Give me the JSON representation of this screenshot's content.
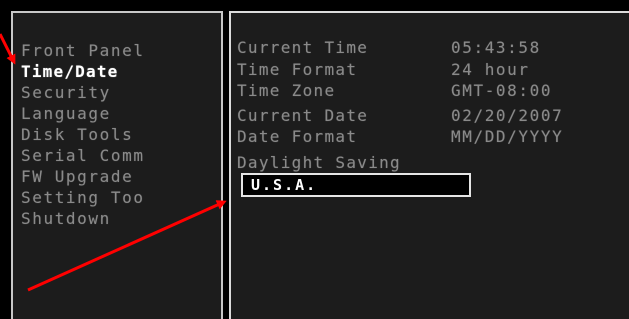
{
  "menu": {
    "items": [
      {
        "label": "Front Panel",
        "selected": false
      },
      {
        "label": "Time/Date",
        "selected": true
      },
      {
        "label": "Security",
        "selected": false
      },
      {
        "label": "Language",
        "selected": false
      },
      {
        "label": "Disk Tools",
        "selected": false
      },
      {
        "label": "Serial Comm",
        "selected": false
      },
      {
        "label": "FW Upgrade",
        "selected": false
      },
      {
        "label": "Setting Too",
        "selected": false
      },
      {
        "label": "Shutdown",
        "selected": false
      }
    ]
  },
  "settings": {
    "rows": [
      {
        "label": "Current Time",
        "value": "05:43:58"
      },
      {
        "label": "Time Format",
        "value": "24 hour"
      },
      {
        "label": "Time Zone",
        "value": "GMT-08:00"
      },
      {
        "label": "Current Date",
        "value": "02/20/2007"
      },
      {
        "label": "Date Format",
        "value": "MM/DD/YYYY"
      },
      {
        "label": "Daylight Saving",
        "value": ""
      }
    ],
    "daylight_saving_value": "U.S.A."
  },
  "colors": {
    "screen_background": "#000000",
    "panel_background": "#1c1c1c",
    "normal_text": "#8a8a8a",
    "selected_text": "#ffffff",
    "annotation_arrow": "#ff0000"
  }
}
